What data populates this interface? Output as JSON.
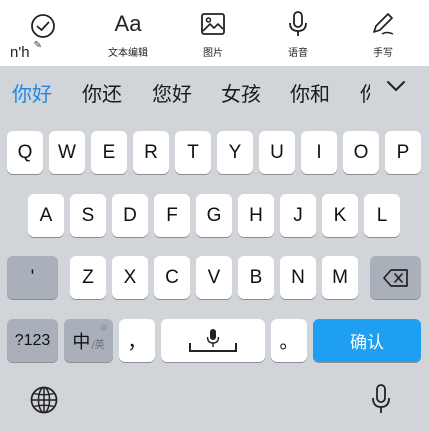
{
  "toolbar": {
    "composing_text": "n'h",
    "items": [
      {
        "icon": "check-circle-icon",
        "label": ""
      },
      {
        "icon": "text-edit-icon",
        "label": "文本编辑",
        "glyph": "Aa"
      },
      {
        "icon": "image-icon",
        "label": "图片"
      },
      {
        "icon": "microphone-icon",
        "label": "语音"
      },
      {
        "icon": "pen-icon",
        "label": "手写"
      }
    ]
  },
  "candidates": [
    "你好",
    "你还",
    "您好",
    "女孩",
    "你和",
    "你"
  ],
  "keyboard": {
    "row1": [
      "Q",
      "W",
      "E",
      "R",
      "T",
      "Y",
      "U",
      "I",
      "O",
      "P"
    ],
    "row2": [
      "A",
      "S",
      "D",
      "F",
      "G",
      "H",
      "J",
      "K",
      "L"
    ],
    "row3": [
      "'",
      "Z",
      "X",
      "C",
      "V",
      "B",
      "N",
      "M"
    ],
    "num_label": "?123",
    "lang_main": "中",
    "lang_sub": "/英",
    "comma": "，",
    "period": "。",
    "confirm_label": "确认"
  },
  "colors": {
    "accent": "#1e9ff2",
    "candidate_active": "#1e88e5",
    "background": "#d1d4d9"
  }
}
